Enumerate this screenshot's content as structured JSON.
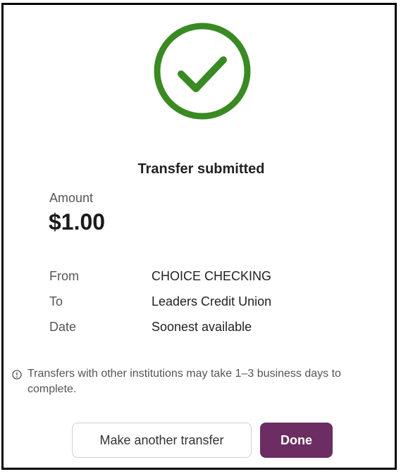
{
  "colors": {
    "success": "#3a8a23",
    "primary": "#6b2d62",
    "border": "#000000"
  },
  "icons": {
    "status": "check-circle-icon",
    "notice": "info-circle-icon"
  },
  "confirmation": {
    "title": "Transfer submitted",
    "amount_label": "Amount",
    "amount_value": "$1.00",
    "details": [
      {
        "label": "From",
        "value": "CHOICE CHECKING"
      },
      {
        "label": "To",
        "value": "Leaders Credit Union"
      },
      {
        "label": "Date",
        "value": "Soonest available"
      }
    ],
    "notice": "Transfers with other institutions may take 1–3 business days to complete."
  },
  "actions": {
    "secondary_label": "Make another transfer",
    "primary_label": "Done"
  }
}
